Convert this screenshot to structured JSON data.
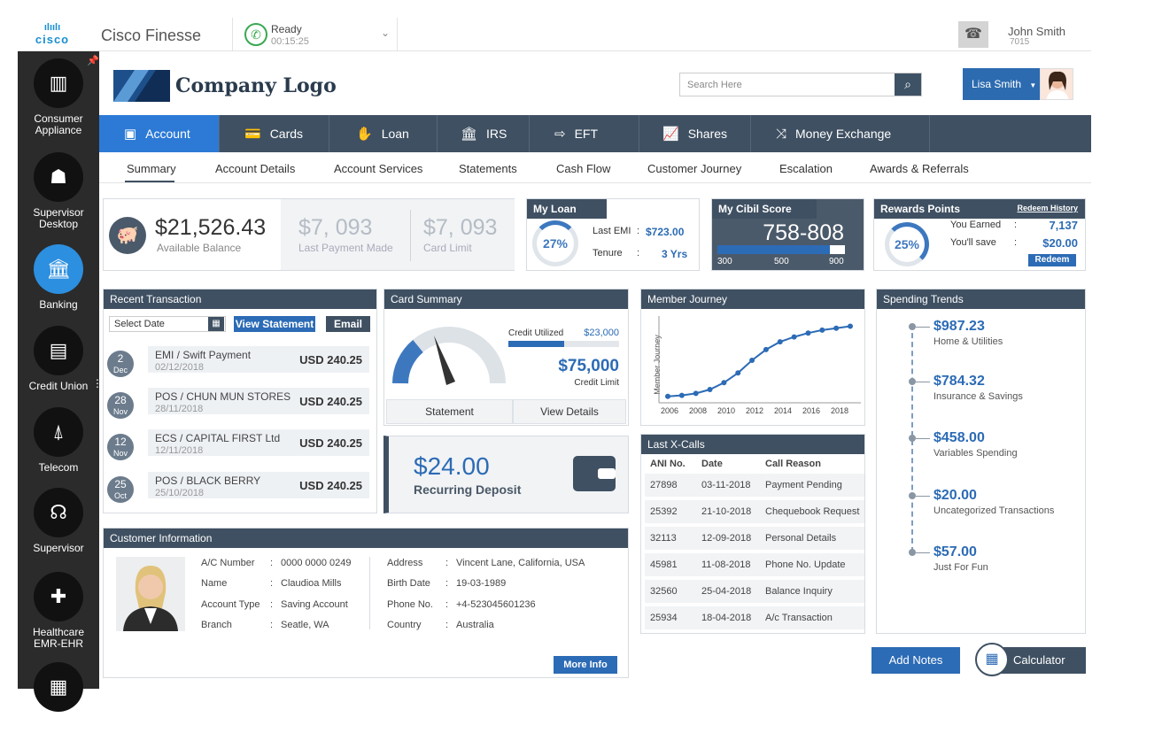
{
  "topbar": {
    "cisco_logo": "cisco",
    "app_title": "Cisco Finesse",
    "status_label": "Ready",
    "status_time": "00:15:25",
    "agent_name": "John Smith",
    "agent_ext": "7015"
  },
  "sidebar": {
    "items": [
      {
        "label": "Consumer Appliance",
        "icon": "appliance-icon"
      },
      {
        "label": "Supervisor Desktop",
        "icon": "supervisor-desktop-icon"
      },
      {
        "label": "Banking",
        "icon": "bank-icon"
      },
      {
        "label": "Credit Union",
        "icon": "credit-union-icon"
      },
      {
        "label": "Telecom",
        "icon": "telecom-icon"
      },
      {
        "label": "Supervisor",
        "icon": "supervisor-icon"
      },
      {
        "label": "Healthcare EMR-EHR",
        "icon": "healthcare-icon"
      }
    ]
  },
  "header": {
    "logo_text": "Company Logo",
    "search_placeholder": "Search Here",
    "user_name": "Lisa Smith"
  },
  "nav": {
    "tabs": [
      {
        "label": "Account",
        "icon": "account-icon"
      },
      {
        "label": "Cards",
        "icon": "cards-icon"
      },
      {
        "label": "Loan",
        "icon": "loan-icon"
      },
      {
        "label": "IRS",
        "icon": "irs-icon"
      },
      {
        "label": "EFT",
        "icon": "eft-icon"
      },
      {
        "label": "Shares",
        "icon": "shares-icon"
      },
      {
        "label": "Money Exchange",
        "icon": "money-exchange-icon"
      }
    ],
    "active": "Account"
  },
  "subnav": {
    "items": [
      "Summary",
      "Account Details",
      "Account Services",
      "Statements",
      "Cash Flow",
      "Customer Journey",
      "Escalation",
      "Awards & Referrals"
    ]
  },
  "balance": {
    "available": "$21,526.43",
    "available_label": "Available Balance",
    "last_payment": "$7, 093",
    "last_payment_label": "Last Payment Made",
    "card_limit": "$7, 093",
    "card_limit_label": "Card Limit"
  },
  "my_loan": {
    "title": "My Loan",
    "percent": "27%",
    "last_emi_label": "Last EMI",
    "last_emi": "$723.00",
    "tenure_label": "Tenure",
    "tenure": "3 Yrs",
    "colon": ":"
  },
  "cibil": {
    "title": "My Cibil Score",
    "score": "758-808",
    "scale_min": "300",
    "scale_mid": "500",
    "scale_max": "900",
    "fill": 0.88
  },
  "rewards": {
    "title": "Rewards Points",
    "history_link": "Redeem History",
    "percent": "25%",
    "earned_label": "You Earned",
    "earned": "7,137",
    "save_label": "You'll save",
    "save": "$20.00",
    "redeem_label": "Redeem"
  },
  "recent_tx": {
    "title": "Recent Transaction",
    "date_placeholder": "Select Date",
    "view_statement": "View Statement",
    "email": "Email",
    "rows": [
      {
        "day": "2",
        "month": "Dec",
        "name": "EMI / Swift Payment",
        "date": "02/12/2018",
        "amount": "USD 240.25"
      },
      {
        "day": "28",
        "month": "Nov",
        "name": "POS / CHUN MUN STORES",
        "date": "28/11/2018",
        "amount": "USD 240.25"
      },
      {
        "day": "12",
        "month": "Nov",
        "name": "ECS / CAPITAL FIRST Ltd",
        "date": "12/11/2018",
        "amount": "USD 240.25"
      },
      {
        "day": "25",
        "month": "Oct",
        "name": "POS / BLACK BERRY",
        "date": "25/10/2018",
        "amount": "USD 240.25"
      }
    ]
  },
  "card_summary": {
    "title": "Card Summary",
    "credit_utilized_label": "Credit Utilized",
    "credit_utilized": "$23,000",
    "credit_limit": "$75,000",
    "credit_limit_label": "Credit Limit",
    "statement": "Statement",
    "view_details": "View Details"
  },
  "deposit": {
    "amount": "$24.00",
    "label": "Recurring Deposit"
  },
  "member_journey": {
    "title": "Member Journey",
    "ylabel": "Member Journey",
    "xlabels": [
      "2006",
      "2008",
      "2010",
      "2012",
      "2014",
      "2016",
      "2018"
    ]
  },
  "chart_data": {
    "type": "line",
    "title": "Member Journey",
    "ylabel": "Member Journey",
    "x": [
      2006,
      2007,
      2008,
      2009,
      2010,
      2011,
      2012,
      2013,
      2014,
      2015,
      2016,
      2017,
      2018,
      2019
    ],
    "values": [
      3,
      4,
      6,
      10,
      17,
      27,
      40,
      51,
      59,
      64,
      68,
      71,
      73,
      75
    ],
    "ylim": [
      0,
      80
    ],
    "grid": false
  },
  "x_calls": {
    "title": "Last X-Calls",
    "headers": [
      "ANI No.",
      "Date",
      "Call Reason"
    ],
    "rows": [
      {
        "ani": "27898",
        "date": "03-11-2018",
        "reason": "Payment Pending"
      },
      {
        "ani": "25392",
        "date": "21-10-2018",
        "reason": "Chequebook Request"
      },
      {
        "ani": "32113",
        "date": "12-09-2018",
        "reason": "Personal Details"
      },
      {
        "ani": "45981",
        "date": "11-08-2018",
        "reason": "Phone No. Update"
      },
      {
        "ani": "32560",
        "date": "25-04-2018",
        "reason": "Balance Inquiry"
      },
      {
        "ani": "25934",
        "date": "18-04-2018",
        "reason": "A/c Transaction"
      }
    ]
  },
  "spending": {
    "title": "Spending Trends",
    "items": [
      {
        "value": "$987.23",
        "label": "Home & Utilities"
      },
      {
        "value": "$784.32",
        "label": "Insurance & Savings"
      },
      {
        "value": "$458.00",
        "label": "Variables Spending"
      },
      {
        "value": "$20.00",
        "label": "Uncategorized Transactions"
      },
      {
        "value": "$57.00",
        "label": "Just For Fun"
      }
    ]
  },
  "customer": {
    "title": "Customer Information",
    "left": [
      {
        "label": "A/C Number",
        "value": "0000 0000 0249"
      },
      {
        "label": "Name",
        "value": "Claudioa Mills"
      },
      {
        "label": "Account Type",
        "value": "Saving Account"
      },
      {
        "label": "Branch",
        "value": "Seatle, WA"
      }
    ],
    "right": [
      {
        "label": "Address",
        "value": "Vincent Lane, California, USA"
      },
      {
        "label": "Birth Date",
        "value": "19-03-1989"
      },
      {
        "label": "Phone No.",
        "value": "+4-523045601236"
      },
      {
        "label": "Country",
        "value": "Australia"
      }
    ],
    "more_info": "More Info",
    "colon": ":"
  },
  "footer": {
    "add_notes": "Add Notes",
    "calculator": "Calculator"
  },
  "colors": {
    "primary": "#2c6bb5",
    "header": "#3f5062",
    "sidebar": "#2b2b2b",
    "active_nav": "#2c7ad6",
    "ready": "#3aa852"
  }
}
